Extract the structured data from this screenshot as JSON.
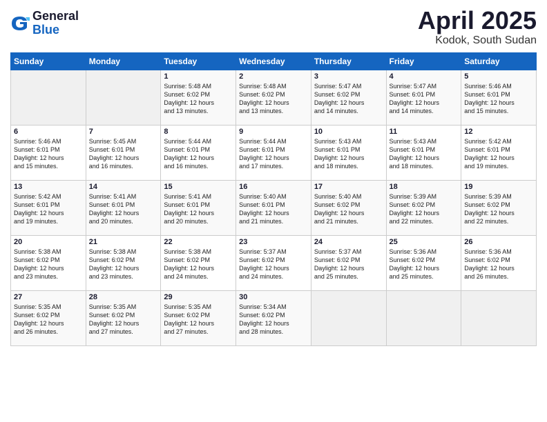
{
  "header": {
    "logo_general": "General",
    "logo_blue": "Blue",
    "month_title": "April 2025",
    "location": "Kodok, South Sudan"
  },
  "calendar": {
    "days_of_week": [
      "Sunday",
      "Monday",
      "Tuesday",
      "Wednesday",
      "Thursday",
      "Friday",
      "Saturday"
    ],
    "weeks": [
      [
        {
          "day": "",
          "content": ""
        },
        {
          "day": "",
          "content": ""
        },
        {
          "day": "1",
          "content": "Sunrise: 5:48 AM\nSunset: 6:02 PM\nDaylight: 12 hours\nand 13 minutes."
        },
        {
          "day": "2",
          "content": "Sunrise: 5:48 AM\nSunset: 6:02 PM\nDaylight: 12 hours\nand 13 minutes."
        },
        {
          "day": "3",
          "content": "Sunrise: 5:47 AM\nSunset: 6:02 PM\nDaylight: 12 hours\nand 14 minutes."
        },
        {
          "day": "4",
          "content": "Sunrise: 5:47 AM\nSunset: 6:01 PM\nDaylight: 12 hours\nand 14 minutes."
        },
        {
          "day": "5",
          "content": "Sunrise: 5:46 AM\nSunset: 6:01 PM\nDaylight: 12 hours\nand 15 minutes."
        }
      ],
      [
        {
          "day": "6",
          "content": "Sunrise: 5:46 AM\nSunset: 6:01 PM\nDaylight: 12 hours\nand 15 minutes."
        },
        {
          "day": "7",
          "content": "Sunrise: 5:45 AM\nSunset: 6:01 PM\nDaylight: 12 hours\nand 16 minutes."
        },
        {
          "day": "8",
          "content": "Sunrise: 5:44 AM\nSunset: 6:01 PM\nDaylight: 12 hours\nand 16 minutes."
        },
        {
          "day": "9",
          "content": "Sunrise: 5:44 AM\nSunset: 6:01 PM\nDaylight: 12 hours\nand 17 minutes."
        },
        {
          "day": "10",
          "content": "Sunrise: 5:43 AM\nSunset: 6:01 PM\nDaylight: 12 hours\nand 18 minutes."
        },
        {
          "day": "11",
          "content": "Sunrise: 5:43 AM\nSunset: 6:01 PM\nDaylight: 12 hours\nand 18 minutes."
        },
        {
          "day": "12",
          "content": "Sunrise: 5:42 AM\nSunset: 6:01 PM\nDaylight: 12 hours\nand 19 minutes."
        }
      ],
      [
        {
          "day": "13",
          "content": "Sunrise: 5:42 AM\nSunset: 6:01 PM\nDaylight: 12 hours\nand 19 minutes."
        },
        {
          "day": "14",
          "content": "Sunrise: 5:41 AM\nSunset: 6:01 PM\nDaylight: 12 hours\nand 20 minutes."
        },
        {
          "day": "15",
          "content": "Sunrise: 5:41 AM\nSunset: 6:01 PM\nDaylight: 12 hours\nand 20 minutes."
        },
        {
          "day": "16",
          "content": "Sunrise: 5:40 AM\nSunset: 6:01 PM\nDaylight: 12 hours\nand 21 minutes."
        },
        {
          "day": "17",
          "content": "Sunrise: 5:40 AM\nSunset: 6:02 PM\nDaylight: 12 hours\nand 21 minutes."
        },
        {
          "day": "18",
          "content": "Sunrise: 5:39 AM\nSunset: 6:02 PM\nDaylight: 12 hours\nand 22 minutes."
        },
        {
          "day": "19",
          "content": "Sunrise: 5:39 AM\nSunset: 6:02 PM\nDaylight: 12 hours\nand 22 minutes."
        }
      ],
      [
        {
          "day": "20",
          "content": "Sunrise: 5:38 AM\nSunset: 6:02 PM\nDaylight: 12 hours\nand 23 minutes."
        },
        {
          "day": "21",
          "content": "Sunrise: 5:38 AM\nSunset: 6:02 PM\nDaylight: 12 hours\nand 23 minutes."
        },
        {
          "day": "22",
          "content": "Sunrise: 5:38 AM\nSunset: 6:02 PM\nDaylight: 12 hours\nand 24 minutes."
        },
        {
          "day": "23",
          "content": "Sunrise: 5:37 AM\nSunset: 6:02 PM\nDaylight: 12 hours\nand 24 minutes."
        },
        {
          "day": "24",
          "content": "Sunrise: 5:37 AM\nSunset: 6:02 PM\nDaylight: 12 hours\nand 25 minutes."
        },
        {
          "day": "25",
          "content": "Sunrise: 5:36 AM\nSunset: 6:02 PM\nDaylight: 12 hours\nand 25 minutes."
        },
        {
          "day": "26",
          "content": "Sunrise: 5:36 AM\nSunset: 6:02 PM\nDaylight: 12 hours\nand 26 minutes."
        }
      ],
      [
        {
          "day": "27",
          "content": "Sunrise: 5:35 AM\nSunset: 6:02 PM\nDaylight: 12 hours\nand 26 minutes."
        },
        {
          "day": "28",
          "content": "Sunrise: 5:35 AM\nSunset: 6:02 PM\nDaylight: 12 hours\nand 27 minutes."
        },
        {
          "day": "29",
          "content": "Sunrise: 5:35 AM\nSunset: 6:02 PM\nDaylight: 12 hours\nand 27 minutes."
        },
        {
          "day": "30",
          "content": "Sunrise: 5:34 AM\nSunset: 6:02 PM\nDaylight: 12 hours\nand 28 minutes."
        },
        {
          "day": "",
          "content": ""
        },
        {
          "day": "",
          "content": ""
        },
        {
          "day": "",
          "content": ""
        }
      ]
    ]
  }
}
